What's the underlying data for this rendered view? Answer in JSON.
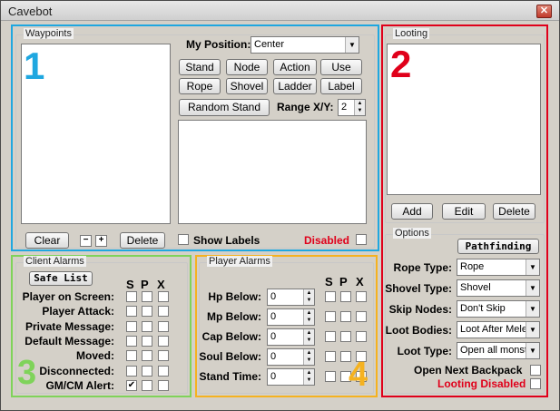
{
  "window": {
    "title": "Cavebot",
    "close_glyph": "✕"
  },
  "waypoints": {
    "label": "Waypoints",
    "region_number": "1",
    "my_position_label": "My Position:",
    "my_position_value": "Center",
    "buttons": [
      "Stand",
      "Node",
      "Action",
      "Use",
      "Rope",
      "Shovel",
      "Ladder",
      "Label"
    ],
    "random_stand": "Random Stand",
    "range_label": "Range X/Y:",
    "range_value": "2",
    "clear": "Clear",
    "minus_glyph": "−",
    "plus_glyph": "+",
    "delete": "Delete",
    "show_labels": "Show Labels",
    "disabled": "Disabled"
  },
  "looting": {
    "label": "Looting",
    "region_number": "2",
    "add": "Add",
    "edit": "Edit",
    "delete": "Delete",
    "options_label": "Options",
    "pathfinding": "Pathfinding",
    "rope_type_label": "Rope Type:",
    "rope_type_value": "Rope",
    "shovel_type_label": "Shovel Type:",
    "shovel_type_value": "Shovel",
    "skip_nodes_label": "Skip Nodes:",
    "skip_nodes_value": "Don't Skip",
    "loot_bodies_label": "Loot Bodies:",
    "loot_bodies_value": "Loot After Mele",
    "loot_type_label": "Loot Type:",
    "loot_type_value": "Open all monst",
    "open_next_backpack": "Open Next Backpack",
    "looting_disabled": "Looting Disabled"
  },
  "client_alarms": {
    "label": "Client Alarms",
    "region_number": "3",
    "safe_list": "Safe List",
    "headers": [
      "S",
      "P",
      "X"
    ],
    "rows": [
      {
        "label": "Player on Screen:",
        "s": false
      },
      {
        "label": "Player Attack:",
        "s": false
      },
      {
        "label": "Private Message:",
        "s": false
      },
      {
        "label": "Default Message:",
        "s": false
      },
      {
        "label": "Moved:",
        "s": false
      },
      {
        "label": "Disconnected:",
        "s": false
      },
      {
        "label": "GM/CM Alert:",
        "s": true
      }
    ],
    "check_glyph": "✔"
  },
  "player_alarms": {
    "label": "Player Alarms",
    "region_number": "4",
    "headers": [
      "S",
      "P",
      "X"
    ],
    "rows": [
      {
        "label": "Hp Below:",
        "value": "0"
      },
      {
        "label": "Mp Below:",
        "value": "0"
      },
      {
        "label": "Cap Below:",
        "value": "0"
      },
      {
        "label": "Soul Below:",
        "value": "0"
      },
      {
        "label": "Stand Time:",
        "value": "0"
      }
    ]
  },
  "colors": {
    "region1": "#1fa7e0",
    "region2": "#e0001a",
    "region3": "#7fd35a",
    "region4": "#f5b220"
  }
}
